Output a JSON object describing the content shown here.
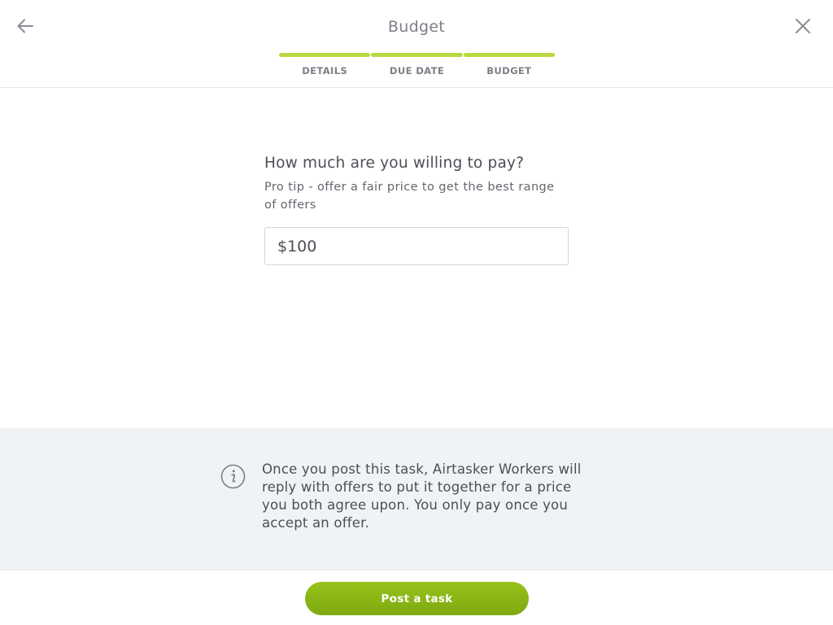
{
  "header": {
    "title": "Budget",
    "back_icon": "arrow-left-icon",
    "close_icon": "close-icon"
  },
  "steps": [
    {
      "label": "DETAILS",
      "complete": true
    },
    {
      "label": "DUE DATE",
      "complete": true
    },
    {
      "label": "BUDGET",
      "complete": true
    }
  ],
  "form": {
    "question": "How much are you willing to pay?",
    "tip": "Pro tip - offer a fair price to get the best range of offers",
    "amount_value": "$100"
  },
  "info": {
    "icon": "info-icon",
    "text": "Once you post this task, Airtasker Workers will reply with offers to put it together for a price you both agree upon. You only pay once you accept an offer."
  },
  "footer": {
    "post_label": "Post a task"
  },
  "colors": {
    "accent": "#b7d83f",
    "button": "#8ab817",
    "panel": "#f0f3f6"
  }
}
